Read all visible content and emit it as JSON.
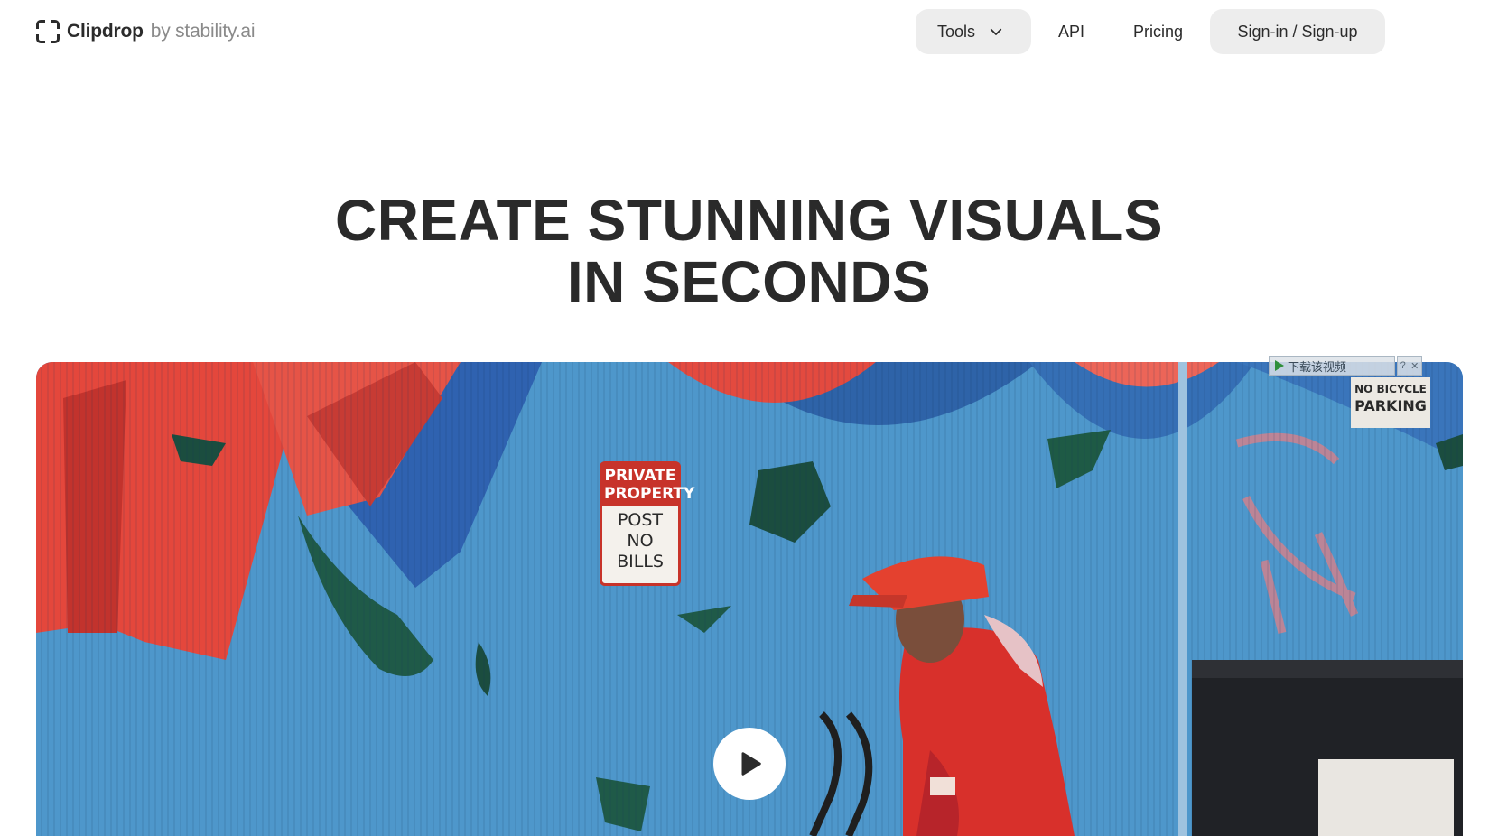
{
  "header": {
    "logo": {
      "name": "Clipdrop",
      "by": "by stability.ai"
    },
    "nav": {
      "tools_label": "Tools",
      "api_label": "API",
      "pricing_label": "Pricing",
      "signin_label": "Sign-in / Sign-up"
    }
  },
  "hero": {
    "title_line1": "CREATE STUNNING VISUALS",
    "title_line2": "IN SECONDS"
  },
  "video": {
    "sign_private_line1": "PRIVATE",
    "sign_private_line2": "PROPERTY",
    "sign_post_line1": "POST",
    "sign_post_line2": "NO",
    "sign_post_line3": "BILLS",
    "sign_parking_line1": "NO BICYCLE",
    "sign_parking_line2": "PARKING",
    "download_bar_label": "下载该视频",
    "download_help": "?",
    "download_close": "✕",
    "play_icon": "play-icon"
  },
  "colors": {
    "nav_button_bg": "#ededed",
    "mural_blue": "#4c95c8",
    "mural_red": "#e4473c",
    "jacket_red": "#d8302b"
  }
}
